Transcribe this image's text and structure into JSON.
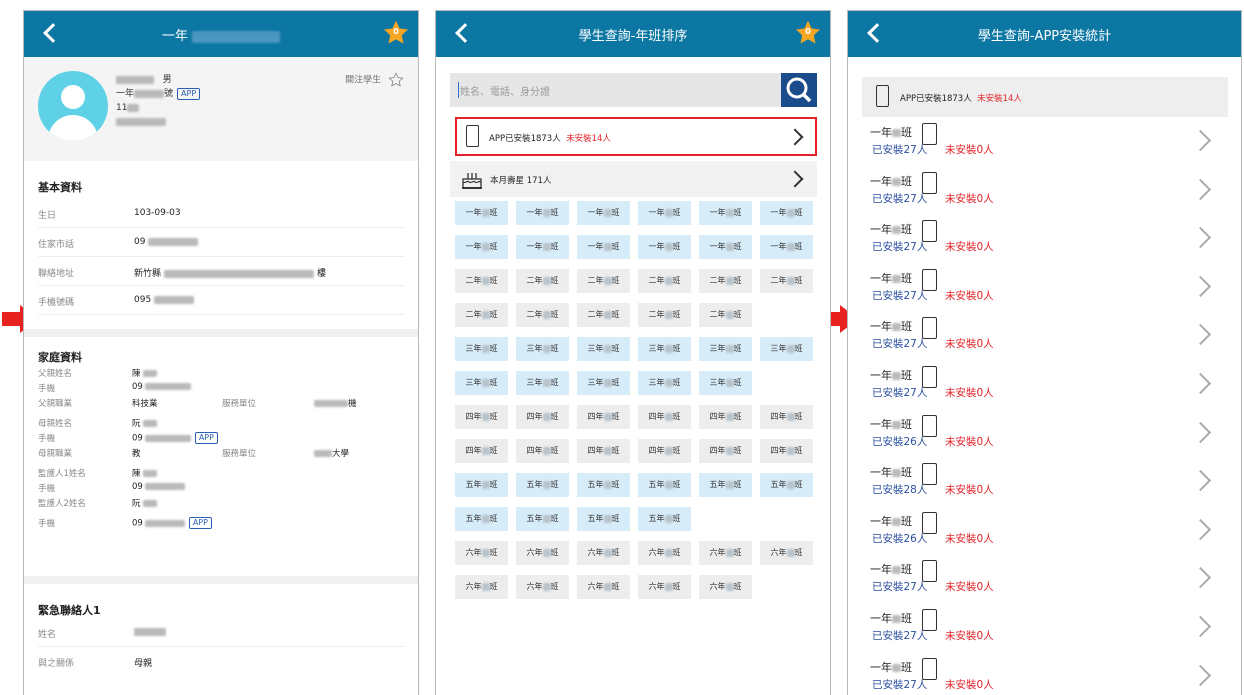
{
  "left": {
    "header": {
      "title": "一年"
    },
    "star_count": "0",
    "profile": {
      "gender": "男",
      "grade_prefix": "一年",
      "seat_suffix": "號",
      "app_tag": "APP",
      "id_prefix": "11"
    },
    "follow_label": "關注學生",
    "basic": {
      "title": "基本資料",
      "rows": [
        {
          "k": "生日",
          "v": "103-09-03"
        },
        {
          "k": "住家市話",
          "v": "09"
        },
        {
          "k": "聯絡地址",
          "v": "新竹縣",
          "tail": "樓"
        },
        {
          "k": "手機號碼",
          "v": "095"
        }
      ]
    },
    "family": {
      "title": "家庭資料",
      "father_name_k": "父親姓名",
      "father_name_v": "陳",
      "phone_k": "手機",
      "father_phone_v": "09",
      "father_job_k": "父親職業",
      "father_job_v": "科技業",
      "employer_k": "服務單位",
      "father_employer_tail": "機",
      "mother_name_k": "母親姓名",
      "mother_name_v": "阮",
      "mother_phone_v": "09",
      "app_tag": "APP",
      "mother_job_k": "母親職業",
      "mother_job_v": "教",
      "mother_employer_tail": "大學",
      "g1_name_k": "監護人1姓名",
      "g1_name_v": "陳",
      "g1_phone_v": "09",
      "g2_name_k": "監護人2姓名",
      "g2_name_v": "阮",
      "g2_phone_v": "09"
    },
    "emergency": {
      "title": "緊急聯絡人1",
      "name_k": "姓名",
      "relation_k": "與之關係",
      "relation_v": "母親"
    }
  },
  "middle": {
    "header": {
      "title": "學生查詢-年班排序"
    },
    "star_count": "0",
    "search": {
      "placeholder": "姓名、電話、身分證"
    },
    "app_row": {
      "installed": "APP已安裝1873人",
      "not_installed": "未安裝14人"
    },
    "birthday_row": {
      "label": "本月壽星 171人"
    },
    "grade_rows": [
      {
        "grade": "一年",
        "count": 6,
        "style": "b"
      },
      {
        "grade": "一年",
        "count": 6,
        "style": "b"
      },
      {
        "grade": "二年",
        "count": 6,
        "style": "g"
      },
      {
        "grade": "二年",
        "count": 5,
        "style": "g"
      },
      {
        "grade": "三年",
        "count": 6,
        "style": "b"
      },
      {
        "grade": "三年",
        "count": 5,
        "style": "b"
      },
      {
        "grade": "四年",
        "count": 6,
        "style": "g"
      },
      {
        "grade": "四年",
        "count": 6,
        "style": "g"
      },
      {
        "grade": "五年",
        "count": 6,
        "style": "b"
      },
      {
        "grade": "五年",
        "count": 4,
        "style": "b"
      },
      {
        "grade": "六年",
        "count": 6,
        "style": "g"
      },
      {
        "grade": "六年",
        "count": 5,
        "style": "g"
      }
    ],
    "class_suffix": "班"
  },
  "right": {
    "header": {
      "title": "學生查詢-APP安裝統計"
    },
    "summary": {
      "installed": "APP已安裝1873人",
      "not_installed": "未安裝14人"
    },
    "items": [
      {
        "name": "一年",
        "suffix": "班",
        "installed": "已安裝27人",
        "not_installed": "未安裝0人"
      },
      {
        "name": "一年",
        "suffix": "班",
        "installed": "已安裝27人",
        "not_installed": "未安裝0人"
      },
      {
        "name": "一年",
        "suffix": "班",
        "installed": "已安裝27人",
        "not_installed": "未安裝0人"
      },
      {
        "name": "一年",
        "suffix": "班",
        "installed": "已安裝27人",
        "not_installed": "未安裝0人"
      },
      {
        "name": "一年",
        "suffix": "班",
        "installed": "已安裝27人",
        "not_installed": "未安裝0人"
      },
      {
        "name": "一年",
        "suffix": "班",
        "installed": "已安裝27人",
        "not_installed": "未安裝0人"
      },
      {
        "name": "一年",
        "suffix": "班",
        "installed": "已安裝26人",
        "not_installed": "未安裝0人"
      },
      {
        "name": "一年",
        "suffix": "班",
        "installed": "已安裝28人",
        "not_installed": "未安裝0人"
      },
      {
        "name": "一年",
        "suffix": "班",
        "installed": "已安裝26人",
        "not_installed": "未安裝0人"
      },
      {
        "name": "一年",
        "suffix": "班",
        "installed": "已安裝27人",
        "not_installed": "未安裝0人"
      },
      {
        "name": "一年",
        "suffix": "班",
        "installed": "已安裝27人",
        "not_installed": "未安裝0人"
      },
      {
        "name": "一年",
        "suffix": "班",
        "installed": "已安裝27人",
        "not_installed": "未安裝0人"
      }
    ]
  },
  "colors": {
    "header": "#0d77a3",
    "accent_red": "#e42127",
    "arrow": "#e8221e",
    "star": "#f6a623",
    "search_button": "#1a4b8a"
  },
  "icons": [
    "back-icon",
    "star-icon",
    "search-icon",
    "phone-icon",
    "chevron-right-icon",
    "birthday-cake-icon",
    "star-outline-icon"
  ]
}
